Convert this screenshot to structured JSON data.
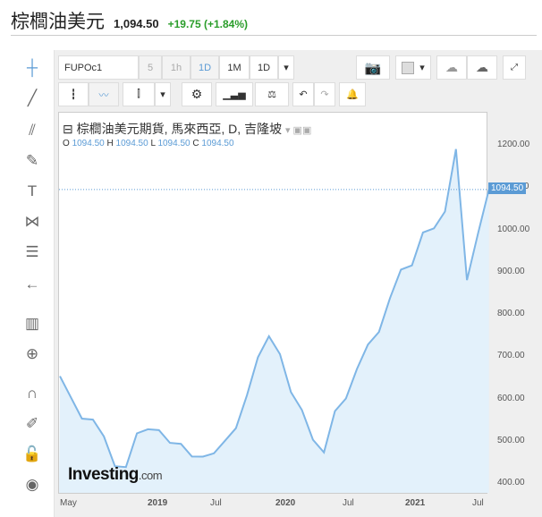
{
  "header": {
    "title": "棕櫚油美元",
    "price": "1,094.50",
    "change": "+19.75 (+1.84%)"
  },
  "toolbar": {
    "symbol": "FUPOc1",
    "intervals": [
      "5",
      "1h",
      "1D",
      "1M",
      "1D"
    ],
    "dropdown": "▾"
  },
  "legend": {
    "title": "棕櫚油美元期貨, 馬來西亞, D, 吉隆坡",
    "o_label": "O",
    "o": "1094.50",
    "h_label": "H",
    "h": "1094.50",
    "l_label": "L",
    "l": "1094.50",
    "c_label": "C",
    "c": "1094.50"
  },
  "logo": {
    "main": "Investing",
    "suffix": ".com"
  },
  "colors": {
    "line": "#7fb6e6",
    "fill": "#e3f1fb",
    "positive": "#2a9d2a"
  },
  "chart_data": {
    "type": "area",
    "title": "棕櫚油美元期貨, 馬來西亞, D, 吉隆坡",
    "x": [
      "2018-05",
      "2018-06",
      "2018-07",
      "2018-08",
      "2018-09",
      "2018-10",
      "2018-11",
      "2018-12",
      "2019-01",
      "2019-02",
      "2019-03",
      "2019-04",
      "2019-05",
      "2019-06",
      "2019-07",
      "2019-08",
      "2019-09",
      "2019-10",
      "2019-11",
      "2019-12",
      "2020-01",
      "2020-02",
      "2020-03",
      "2020-04",
      "2020-05",
      "2020-06",
      "2020-07",
      "2020-08",
      "2020-09",
      "2020-10",
      "2020-11",
      "2020-12",
      "2021-01",
      "2021-02",
      "2021-03",
      "2021-04",
      "2021-05",
      "2021-06",
      "2021-07",
      "2021-07-end"
    ],
    "values": [
      640,
      600,
      560,
      540,
      510,
      450,
      430,
      520,
      540,
      520,
      500,
      480,
      460,
      470,
      460,
      500,
      540,
      600,
      700,
      760,
      700,
      620,
      560,
      500,
      480,
      560,
      600,
      680,
      720,
      760,
      850,
      900,
      920,
      980,
      1000,
      1050,
      1180,
      880,
      1000,
      1094.5
    ],
    "yticks": [
      "1200.00",
      "1100.00",
      "1000.00",
      "900.00",
      "800.00",
      "700.00",
      "600.00",
      "500.00",
      "400.00"
    ],
    "xticks": [
      "May",
      "2019",
      "Jul",
      "2020",
      "Jul",
      "2021",
      "Jul"
    ],
    "ylim": [
      400,
      1200
    ],
    "last_price_label": "1094.50"
  }
}
